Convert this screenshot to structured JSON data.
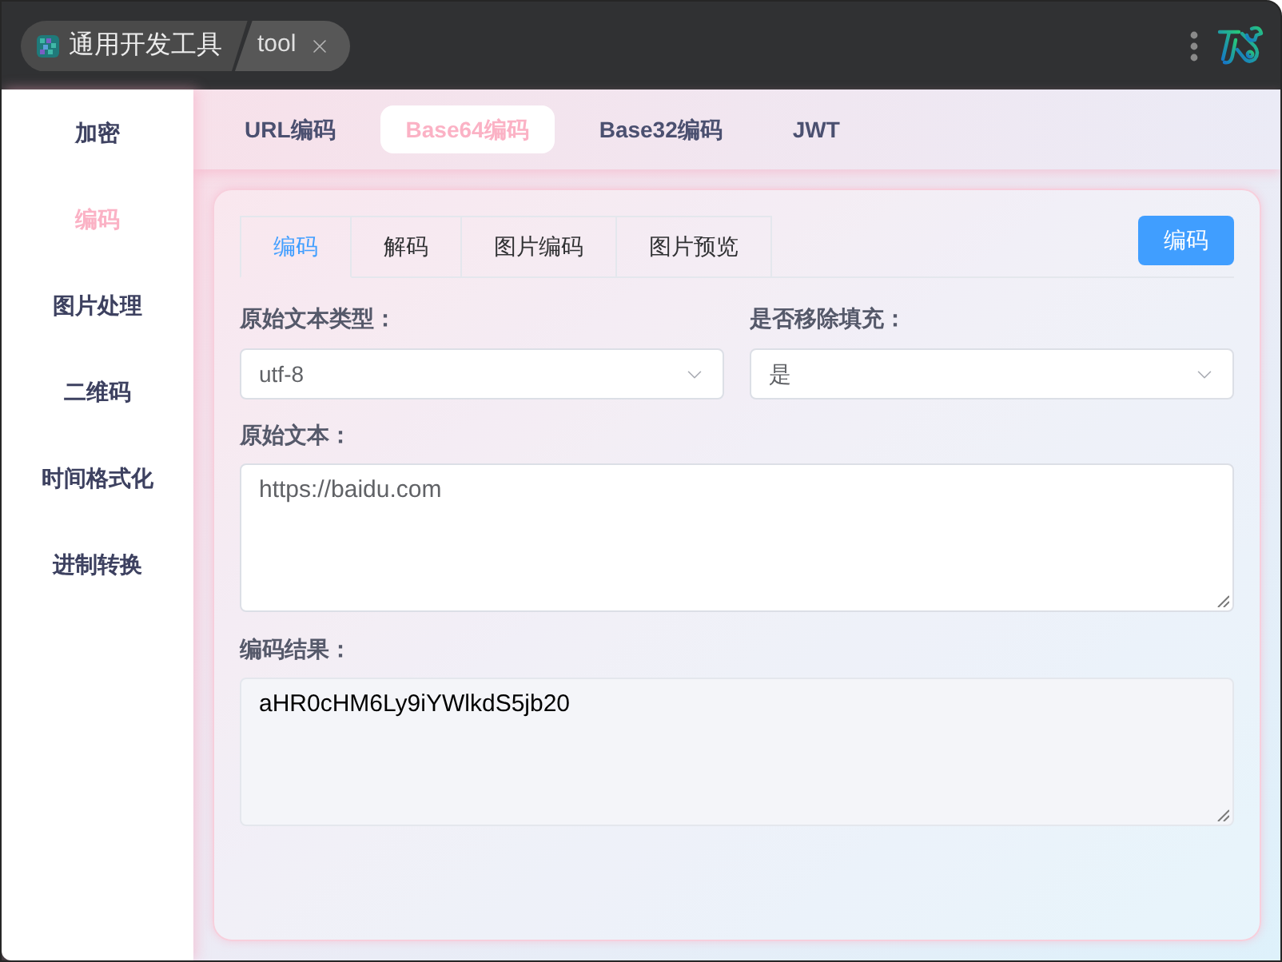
{
  "title_bar": {
    "app_name": "通用开发工具",
    "page_tab": "tool"
  },
  "sidebar": {
    "items": [
      {
        "label": "加密",
        "selected": false
      },
      {
        "label": "编码",
        "selected": true
      },
      {
        "label": "图片处理",
        "selected": false
      },
      {
        "label": "二维码",
        "selected": false
      },
      {
        "label": "时间格式化",
        "selected": false
      },
      {
        "label": "进制转换",
        "selected": false
      }
    ]
  },
  "top_tabs": [
    {
      "label": "URL编码",
      "selected": false
    },
    {
      "label": "Base64编码",
      "selected": true
    },
    {
      "label": "Base32编码",
      "selected": false
    },
    {
      "label": "JWT",
      "selected": false
    }
  ],
  "panel": {
    "tabs": [
      {
        "label": "编码",
        "selected": true
      },
      {
        "label": "解码",
        "selected": false
      },
      {
        "label": "图片编码",
        "selected": false
      },
      {
        "label": "图片预览",
        "selected": false
      }
    ],
    "action_button": "编码",
    "selects": [
      {
        "label": "原始文本类型：",
        "value": "utf-8"
      },
      {
        "label": "是否移除填充：",
        "value": "是"
      }
    ],
    "text_areas": [
      {
        "label": "原始文本：",
        "value": "https://baidu.com",
        "readonly": false
      },
      {
        "label": "编码结果：",
        "value": "aHR0cHM6Ly9iYWlkdS5jb20",
        "readonly": true
      }
    ]
  }
}
